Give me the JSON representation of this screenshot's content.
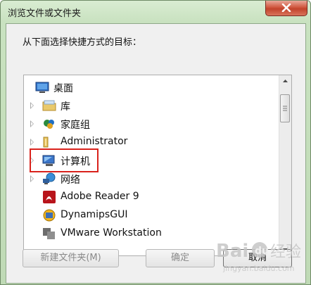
{
  "window": {
    "title": "浏览文件或文件夹"
  },
  "dialog": {
    "prompt": "从下面选择快捷方式的目标："
  },
  "tree": {
    "items": [
      {
        "label": "桌面",
        "icon": "desktop-icon",
        "expandable": false
      },
      {
        "label": "库",
        "icon": "library-icon",
        "expandable": true
      },
      {
        "label": "家庭组",
        "icon": "homegroup-icon",
        "expandable": true
      },
      {
        "label": "Administrator",
        "icon": "user-folder-icon",
        "expandable": true
      },
      {
        "label": "计算机",
        "icon": "computer-icon",
        "expandable": true,
        "highlighted": true
      },
      {
        "label": "网络",
        "icon": "network-icon",
        "expandable": true
      },
      {
        "label": "Adobe Reader 9",
        "icon": "adobe-reader-icon",
        "expandable": false
      },
      {
        "label": "DynamipsGUI",
        "icon": "dynamips-icon",
        "expandable": false
      },
      {
        "label": "VMware Workstation",
        "icon": "vmware-icon",
        "expandable": false
      }
    ]
  },
  "buttons": {
    "new_folder": "新建文件夹(M)",
    "ok": "确定",
    "cancel": "取消"
  },
  "watermark": {
    "brand": "Bai",
    "du": "du",
    "suffix": "经验",
    "url": "jingyan.baidu.com"
  },
  "colors": {
    "highlight_box": "#d9221c",
    "titlebar": "#c9e2c0",
    "close_button": "#c2432c"
  }
}
